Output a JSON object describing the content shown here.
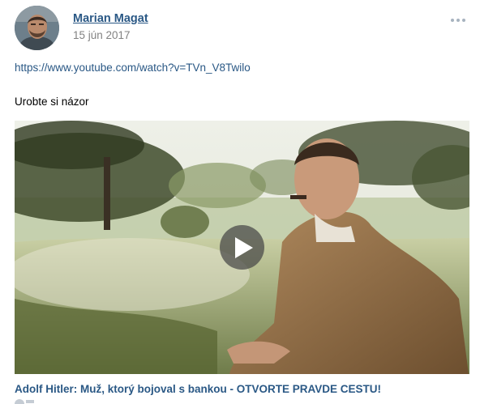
{
  "post": {
    "author": "Marian Magat",
    "date": "15 jún 2017",
    "link": "https://www.youtube.com/watch?v=TVn_V8Twilo",
    "text": "Urobte si názor",
    "more_icon": "ellipsis-icon",
    "avatar_icon": "user-avatar"
  },
  "video": {
    "title": "Adolf Hitler: Muž, ktorý bojoval s bankou - OTVORTE PRAVDE CESTU!",
    "play_icon": "play-icon"
  },
  "colors": {
    "link": "#2a5885",
    "muted": "#828282",
    "dots": "#a7b3bf"
  }
}
